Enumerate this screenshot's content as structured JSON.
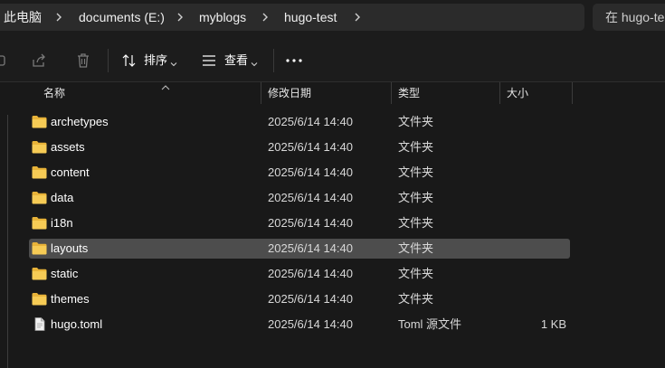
{
  "breadcrumb": {
    "items": [
      "此电脑",
      "documents (E:)",
      "myblogs",
      "hugo-test"
    ]
  },
  "search": {
    "placeholder": "在 hugo-te"
  },
  "toolbar": {
    "sort_label": "排序",
    "view_label": "查看",
    "more_label": "•••"
  },
  "columns": {
    "name": "名称",
    "modified": "修改日期",
    "type": "类型",
    "size": "大小"
  },
  "files": [
    {
      "name": "archetypes",
      "modified": "2025/6/14 14:40",
      "type": "文件夹",
      "size": "",
      "icon": "folder-icon"
    },
    {
      "name": "assets",
      "modified": "2025/6/14 14:40",
      "type": "文件夹",
      "size": "",
      "icon": "folder-icon"
    },
    {
      "name": "content",
      "modified": "2025/6/14 14:40",
      "type": "文件夹",
      "size": "",
      "icon": "folder-icon"
    },
    {
      "name": "data",
      "modified": "2025/6/14 14:40",
      "type": "文件夹",
      "size": "",
      "icon": "folder-icon"
    },
    {
      "name": "i18n",
      "modified": "2025/6/14 14:40",
      "type": "文件夹",
      "size": "",
      "icon": "folder-icon"
    },
    {
      "name": "layouts",
      "modified": "2025/6/14 14:40",
      "type": "文件夹",
      "size": "",
      "icon": "folder-icon",
      "selected": true
    },
    {
      "name": "static",
      "modified": "2025/6/14 14:40",
      "type": "文件夹",
      "size": "",
      "icon": "folder-icon"
    },
    {
      "name": "themes",
      "modified": "2025/6/14 14:40",
      "type": "文件夹",
      "size": "",
      "icon": "folder-icon"
    },
    {
      "name": "hugo.toml",
      "modified": "2025/6/14 14:40",
      "type": "Toml 源文件",
      "size": "1 KB",
      "icon": "file-icon"
    }
  ],
  "colors": {
    "background": "#191919",
    "selection": "#4d4d4d",
    "folder": "#f0c24a"
  }
}
